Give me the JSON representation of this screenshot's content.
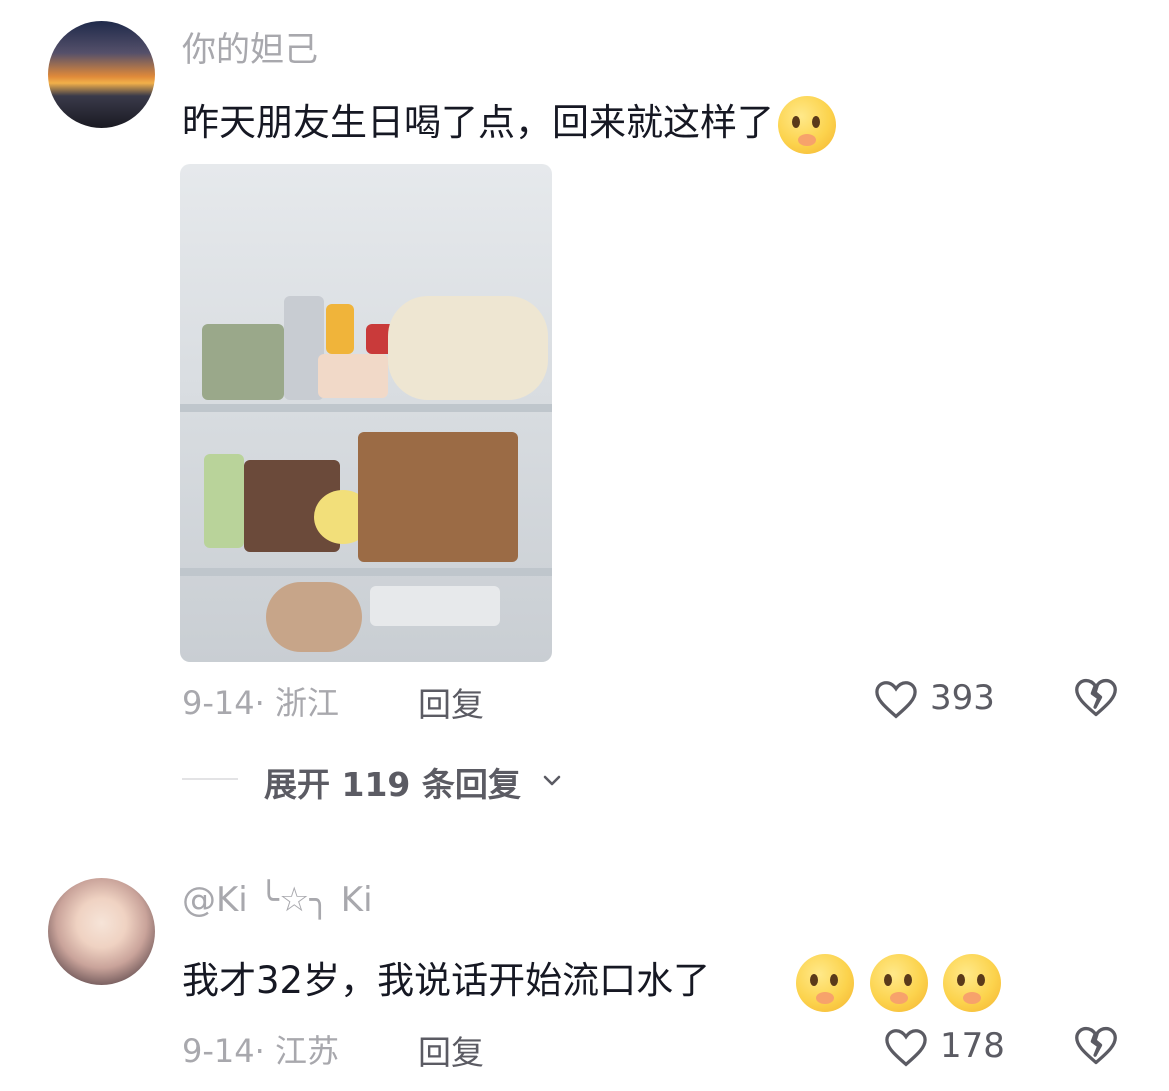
{
  "comments": [
    {
      "username": "你的妲己",
      "text": "昨天朋友生日喝了点，回来就这样了",
      "emojis": [
        "kiss-face-emoji"
      ],
      "date": "9-14",
      "location": "浙江",
      "reply_label": "回复",
      "likes": "393",
      "has_image": true
    },
    {
      "username": "@Ki ╰☆╮ Ki",
      "text": "我才32岁，我说话开始流口水了",
      "emojis": [
        "crying-pleading-face-emoji",
        "crying-pleading-face-emoji",
        "crying-pleading-face-emoji"
      ],
      "date": "9-14",
      "location": "江苏",
      "reply_label": "回复",
      "likes": "178",
      "has_image": false
    }
  ],
  "expand_replies": "展开 119 条回复",
  "meta_separator": "·",
  "colors": {
    "text_primary": "#161823",
    "text_secondary": "#a8a8ad",
    "text_action": "#5b5b63"
  },
  "icons": {
    "like": "heart-outline-icon",
    "dislike": "broken-heart-icon",
    "expand": "chevron-down-icon"
  }
}
